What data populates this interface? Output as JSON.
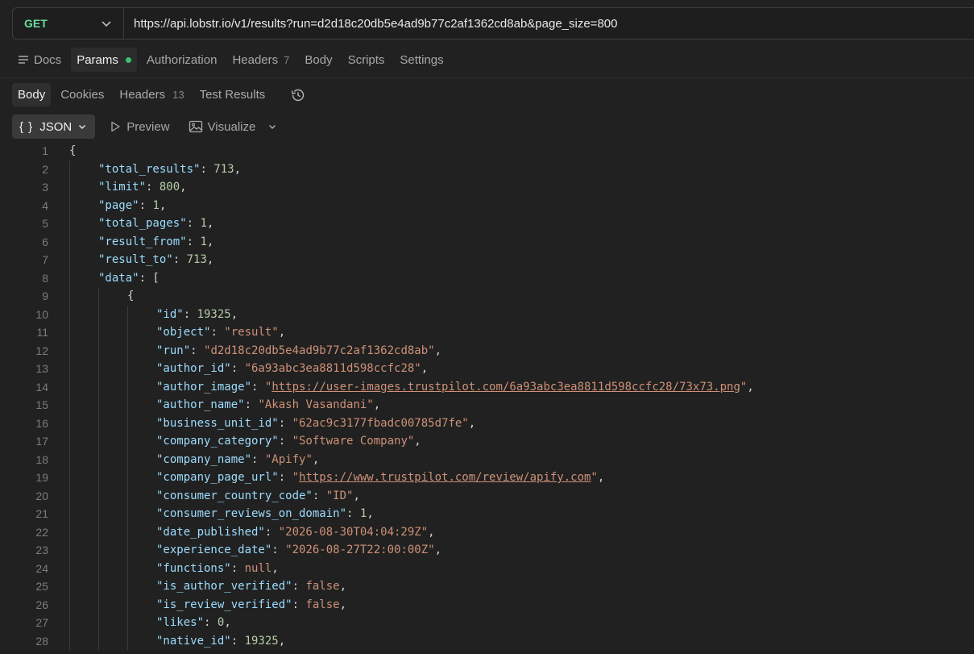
{
  "request": {
    "method": "GET",
    "url": "https://api.lobstr.io/v1/results?run=d2d18c20db5e4ad9b77c2af1362cd8ab&page_size=800"
  },
  "request_tabs": [
    {
      "label": "Docs"
    },
    {
      "label": "Params",
      "active": true,
      "dot": true
    },
    {
      "label": "Authorization"
    },
    {
      "label": "Headers",
      "count": "7"
    },
    {
      "label": "Body"
    },
    {
      "label": "Scripts"
    },
    {
      "label": "Settings"
    }
  ],
  "response_tabs": [
    {
      "label": "Body",
      "active": true
    },
    {
      "label": "Cookies"
    },
    {
      "label": "Headers",
      "count": "13"
    },
    {
      "label": "Test Results"
    }
  ],
  "view_toolbar": {
    "format": "JSON",
    "format_braces": "{ }",
    "preview": "Preview",
    "visualize": "Visualize"
  },
  "code_lines": [
    {
      "n": "1",
      "indent": 0,
      "tokens": [
        [
          "p",
          "{"
        ]
      ]
    },
    {
      "n": "2",
      "indent": 1,
      "tokens": [
        [
          "k",
          "\"total_results\""
        ],
        [
          "p",
          ": "
        ],
        [
          "n",
          "713"
        ],
        [
          "p",
          ","
        ]
      ]
    },
    {
      "n": "3",
      "indent": 1,
      "tokens": [
        [
          "k",
          "\"limit\""
        ],
        [
          "p",
          ": "
        ],
        [
          "n",
          "800"
        ],
        [
          "p",
          ","
        ]
      ]
    },
    {
      "n": "4",
      "indent": 1,
      "tokens": [
        [
          "k",
          "\"page\""
        ],
        [
          "p",
          ": "
        ],
        [
          "n",
          "1"
        ],
        [
          "p",
          ","
        ]
      ]
    },
    {
      "n": "5",
      "indent": 1,
      "tokens": [
        [
          "k",
          "\"total_pages\""
        ],
        [
          "p",
          ": "
        ],
        [
          "n",
          "1"
        ],
        [
          "p",
          ","
        ]
      ]
    },
    {
      "n": "6",
      "indent": 1,
      "tokens": [
        [
          "k",
          "\"result_from\""
        ],
        [
          "p",
          ": "
        ],
        [
          "n",
          "1"
        ],
        [
          "p",
          ","
        ]
      ]
    },
    {
      "n": "7",
      "indent": 1,
      "tokens": [
        [
          "k",
          "\"result_to\""
        ],
        [
          "p",
          ": "
        ],
        [
          "n",
          "713"
        ],
        [
          "p",
          ","
        ]
      ]
    },
    {
      "n": "8",
      "indent": 1,
      "tokens": [
        [
          "k",
          "\"data\""
        ],
        [
          "p",
          ": ["
        ]
      ]
    },
    {
      "n": "9",
      "indent": 2,
      "tokens": [
        [
          "p",
          "{"
        ]
      ]
    },
    {
      "n": "10",
      "indent": 3,
      "tokens": [
        [
          "k",
          "\"id\""
        ],
        [
          "p",
          ": "
        ],
        [
          "n",
          "19325"
        ],
        [
          "p",
          ","
        ]
      ]
    },
    {
      "n": "11",
      "indent": 3,
      "tokens": [
        [
          "k",
          "\"object\""
        ],
        [
          "p",
          ": "
        ],
        [
          "s",
          "\"result\""
        ],
        [
          "p",
          ","
        ]
      ]
    },
    {
      "n": "12",
      "indent": 3,
      "tokens": [
        [
          "k",
          "\"run\""
        ],
        [
          "p",
          ": "
        ],
        [
          "s",
          "\"d2d18c20db5e4ad9b77c2af1362cd8ab\""
        ],
        [
          "p",
          ","
        ]
      ]
    },
    {
      "n": "13",
      "indent": 3,
      "tokens": [
        [
          "k",
          "\"author_id\""
        ],
        [
          "p",
          ": "
        ],
        [
          "s",
          "\"6a93abc3ea8811d598ccfc28\""
        ],
        [
          "p",
          ","
        ]
      ]
    },
    {
      "n": "14",
      "indent": 3,
      "tokens": [
        [
          "k",
          "\"author_image\""
        ],
        [
          "p",
          ": "
        ],
        [
          "s",
          "\""
        ],
        [
          "lnk",
          "https://user-images.trustpilot.com/6a93abc3ea8811d598ccfc28/73x73.png"
        ],
        [
          "s",
          "\""
        ],
        [
          "p",
          ","
        ]
      ]
    },
    {
      "n": "15",
      "indent": 3,
      "tokens": [
        [
          "k",
          "\"author_name\""
        ],
        [
          "p",
          ": "
        ],
        [
          "s",
          "\"Akash Vasandani\""
        ],
        [
          "p",
          ","
        ]
      ]
    },
    {
      "n": "16",
      "indent": 3,
      "tokens": [
        [
          "k",
          "\"business_unit_id\""
        ],
        [
          "p",
          ": "
        ],
        [
          "s",
          "\"62ac9c3177fbadc00785d7fe\""
        ],
        [
          "p",
          ","
        ]
      ]
    },
    {
      "n": "17",
      "indent": 3,
      "tokens": [
        [
          "k",
          "\"company_category\""
        ],
        [
          "p",
          ": "
        ],
        [
          "s",
          "\"Software Company\""
        ],
        [
          "p",
          ","
        ]
      ]
    },
    {
      "n": "18",
      "indent": 3,
      "tokens": [
        [
          "k",
          "\"company_name\""
        ],
        [
          "p",
          ": "
        ],
        [
          "s",
          "\"Apify\""
        ],
        [
          "p",
          ","
        ]
      ]
    },
    {
      "n": "19",
      "indent": 3,
      "tokens": [
        [
          "k",
          "\"company_page_url\""
        ],
        [
          "p",
          ": "
        ],
        [
          "s",
          "\""
        ],
        [
          "lnk",
          "https://www.trustpilot.com/review/apify.com"
        ],
        [
          "s",
          "\""
        ],
        [
          "p",
          ","
        ]
      ]
    },
    {
      "n": "20",
      "indent": 3,
      "tokens": [
        [
          "k",
          "\"consumer_country_code\""
        ],
        [
          "p",
          ": "
        ],
        [
          "s",
          "\"ID\""
        ],
        [
          "p",
          ","
        ]
      ]
    },
    {
      "n": "21",
      "indent": 3,
      "tokens": [
        [
          "k",
          "\"consumer_reviews_on_domain\""
        ],
        [
          "p",
          ": "
        ],
        [
          "n",
          "1"
        ],
        [
          "p",
          ","
        ]
      ]
    },
    {
      "n": "22",
      "indent": 3,
      "tokens": [
        [
          "k",
          "\"date_published\""
        ],
        [
          "p",
          ": "
        ],
        [
          "s",
          "\"2026-08-30T04:04:29Z\""
        ],
        [
          "p",
          ","
        ]
      ]
    },
    {
      "n": "23",
      "indent": 3,
      "tokens": [
        [
          "k",
          "\"experience_date\""
        ],
        [
          "p",
          ": "
        ],
        [
          "s",
          "\"2026-08-27T22:00:00Z\""
        ],
        [
          "p",
          ","
        ]
      ]
    },
    {
      "n": "24",
      "indent": 3,
      "tokens": [
        [
          "k",
          "\"functions\""
        ],
        [
          "p",
          ": "
        ],
        [
          "kw",
          "null"
        ],
        [
          "p",
          ","
        ]
      ]
    },
    {
      "n": "25",
      "indent": 3,
      "tokens": [
        [
          "k",
          "\"is_author_verified\""
        ],
        [
          "p",
          ": "
        ],
        [
          "kw",
          "false"
        ],
        [
          "p",
          ","
        ]
      ]
    },
    {
      "n": "26",
      "indent": 3,
      "tokens": [
        [
          "k",
          "\"is_review_verified\""
        ],
        [
          "p",
          ": "
        ],
        [
          "kw",
          "false"
        ],
        [
          "p",
          ","
        ]
      ]
    },
    {
      "n": "27",
      "indent": 3,
      "tokens": [
        [
          "k",
          "\"likes\""
        ],
        [
          "p",
          ": "
        ],
        [
          "n",
          "0"
        ],
        [
          "p",
          ","
        ]
      ]
    },
    {
      "n": "28",
      "indent": 3,
      "tokens": [
        [
          "k",
          "\"native_id\""
        ],
        [
          "p",
          ": "
        ],
        [
          "n",
          "19325"
        ],
        [
          "p",
          ","
        ]
      ]
    }
  ]
}
